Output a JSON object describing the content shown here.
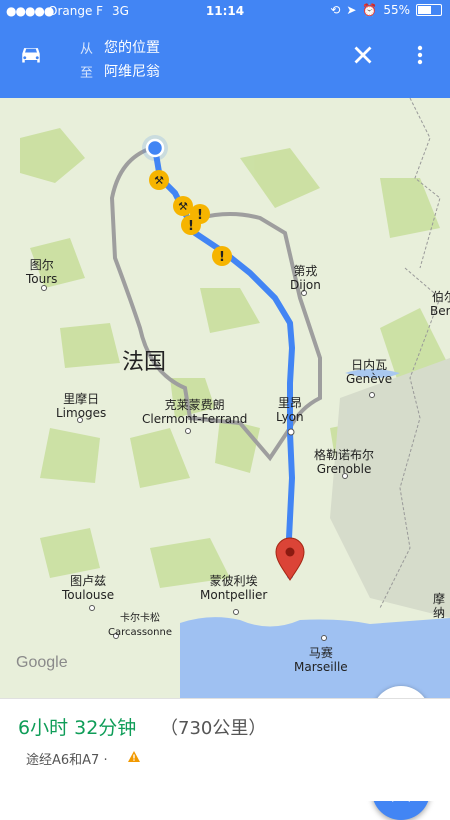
{
  "status_bar": {
    "carrier": "Orange F",
    "network": "3G",
    "time": "11:14",
    "battery": "55%",
    "battery_level": 0.55
  },
  "header": {
    "from_label": "从",
    "from_value": "您的位置",
    "to_label": "至",
    "to_value": "阿维尼翁",
    "accent": "#4285f4"
  },
  "map": {
    "country_label": "法国",
    "cities": [
      {
        "zh": "图尔",
        "en": "Tours"
      },
      {
        "zh": "第戎",
        "en": "Dijon"
      },
      {
        "zh": "日内瓦",
        "en": "Genève"
      },
      {
        "zh": "里摩日",
        "en": "Limoges"
      },
      {
        "zh": "克莱蒙费朗",
        "en": "Clermont-Ferrand"
      },
      {
        "zh": "里昂",
        "en": "Lyon"
      },
      {
        "zh": "格勒诺布尔",
        "en": "Grenoble"
      },
      {
        "zh": "图卢兹",
        "en": "Toulouse"
      },
      {
        "zh": "蒙彼利埃",
        "en": "Montpellier"
      },
      {
        "zh": "卡尔卡松",
        "en": "Carcassonne"
      },
      {
        "zh": "马赛",
        "en": "Marseille"
      },
      {
        "zh": "伯尔",
        "en": "Bern"
      },
      {
        "zh": "摩纳",
        "en": ""
      }
    ],
    "logo": "Google",
    "route_color": "#4285f4"
  },
  "summary": {
    "duration": "6小时 32分钟",
    "distance": "（730公里）",
    "via": "途经A6和A7 ·",
    "duration_color": "#0f9d58"
  }
}
